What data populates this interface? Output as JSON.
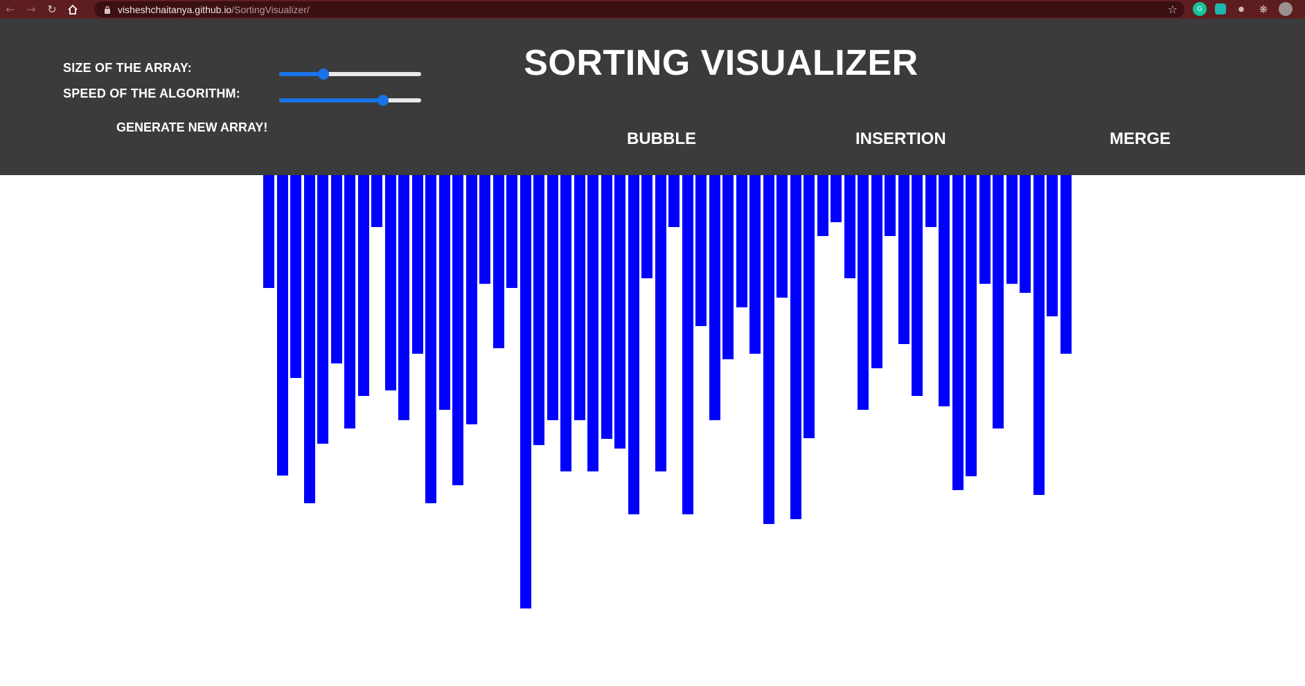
{
  "browser": {
    "url_host": "visheshchaitanya.github.io",
    "url_path": "/SortingVisualizer/",
    "nav_back_icon": "arrow-left-icon",
    "nav_forward_icon": "arrow-right-icon",
    "reload_icon": "reload-icon",
    "home_icon": "home-icon",
    "bookmark_icon": "star-icon",
    "chrome_color": "#5e1d1f"
  },
  "controls": {
    "size_label": "SIZE OF THE ARRAY:",
    "speed_label": "SPEED OF THE ALGORITHM:",
    "size_value_fraction": 0.31,
    "speed_value_fraction": 0.73,
    "generate_label": "GENERATE NEW ARRAY!"
  },
  "title": "SORTING VISUALIZER",
  "algorithms": {
    "bubble": "BUBBLE",
    "insertion": "INSERTION",
    "merge": "MERGE"
  },
  "colors": {
    "header_bg": "#3b3b3b",
    "bar": "#0000ff",
    "slider_accent": "#1a73e8"
  },
  "chart_data": {
    "type": "bar",
    "orientation": "hanging from top",
    "values": [
      163,
      434,
      293,
      474,
      388,
      272,
      366,
      319,
      75,
      311,
      354,
      258,
      474,
      339,
      448,
      360,
      157,
      250,
      163,
      626,
      390,
      354,
      428,
      354,
      428,
      381,
      395,
      490,
      149,
      428,
      75,
      490,
      218,
      354,
      266,
      191,
      258,
      504,
      177,
      497,
      380,
      88,
      68,
      149,
      339,
      279,
      88,
      244,
      319,
      75,
      334,
      455,
      435,
      157,
      366,
      157,
      170,
      462,
      204,
      258
    ]
  }
}
